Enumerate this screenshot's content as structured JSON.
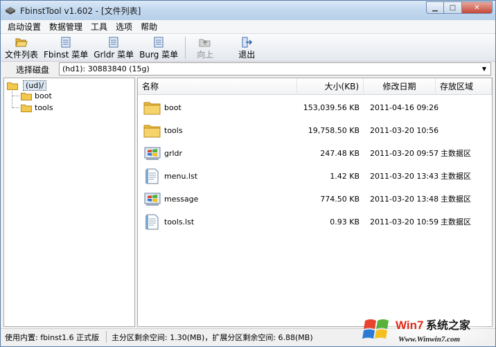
{
  "window": {
    "title": "FbinstTool v1.602 - [文件列表]"
  },
  "menu": [
    "启动设置",
    "数据管理",
    "工具",
    "选项",
    "帮助"
  ],
  "toolbar": {
    "file_list": "文件列表",
    "fbinst_menu": "Fbinst 菜单",
    "grldr_menu": "Grldr 菜单",
    "burg_menu": "Burg 菜单",
    "up": "向上",
    "exit": "退出"
  },
  "disk": {
    "label": "选择磁盘",
    "selected": "(hd1): 30883840 (15g)"
  },
  "tree": {
    "root": "(ud)/",
    "children": [
      "boot",
      "tools"
    ]
  },
  "list": {
    "columns": [
      "名称",
      "大小(KB)",
      "修改日期",
      "存放区域"
    ],
    "rows": [
      {
        "name": "boot",
        "size": "153,039.56 KB",
        "date": "2011-04-16 09:26",
        "area": "",
        "icon": "folder-icon"
      },
      {
        "name": "tools",
        "size": "19,758.50 KB",
        "date": "2011-03-20 10:56",
        "area": "",
        "icon": "folder-icon"
      },
      {
        "name": "grldr",
        "size": "247.48 KB",
        "date": "2011-03-20 09:57",
        "area": "主数据区",
        "icon": "windows-file-icon"
      },
      {
        "name": "menu.lst",
        "size": "1.42 KB",
        "date": "2011-03-20 13:43",
        "area": "主数据区",
        "icon": "text-file-icon"
      },
      {
        "name": "message",
        "size": "774.50 KB",
        "date": "2011-03-20 13:48",
        "area": "主数据区",
        "icon": "windows-file-icon"
      },
      {
        "name": "tools.lst",
        "size": "0.93 KB",
        "date": "2011-03-20 10:59",
        "area": "主数据区",
        "icon": "text-file-icon"
      }
    ]
  },
  "status": {
    "builtin": "使用内置: fbinst1.6 正式版",
    "space": "主分区剩余空间: 1.30(MB)，扩展分区剩余空间: 6.88(MB)"
  },
  "watermark": {
    "brand_a": "Win7",
    "brand_b": "系统之家",
    "url": "Www.Winwin7.com"
  },
  "colors": {
    "titlebar": "#c3d9ef",
    "selection": "#dbe8f6",
    "folder": "#f2c94c"
  }
}
